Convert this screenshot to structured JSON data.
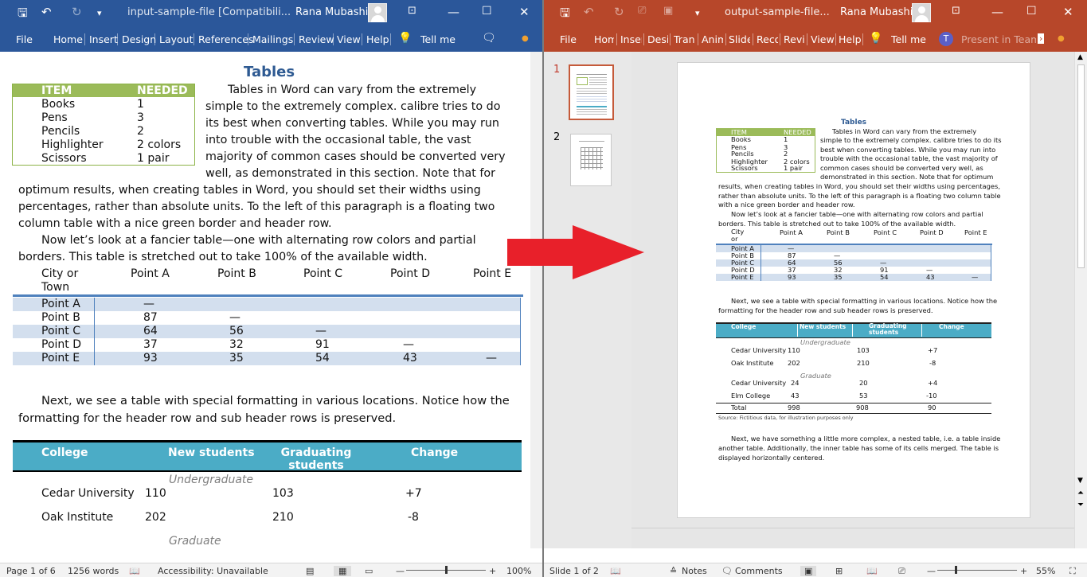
{
  "word": {
    "title": "input-sample-file [Compatibili...",
    "user": "Rana Mubashir",
    "menu": [
      "File",
      "Home",
      "Insert",
      "Design",
      "Layout",
      "References",
      "Mailings",
      "Review",
      "View",
      "Help",
      "Tell me"
    ],
    "doc": {
      "title": "Tables",
      "green_table": {
        "headers": [
          "ITEM",
          "NEEDED"
        ],
        "rows": [
          [
            "Books",
            "1"
          ],
          [
            "Pens",
            "3"
          ],
          [
            "Pencils",
            "2"
          ],
          [
            "Highlighter",
            "2 colors"
          ],
          [
            "Scissors",
            "1 pair"
          ]
        ]
      },
      "para1_lines": [
        "Tables in Word can vary from the extremely",
        "simple to the extremely complex. calibre tries to do",
        "its best when converting tables. While you may run",
        "into trouble with the occasional table, the vast",
        "majority of common cases should be converted very",
        "well, as demonstrated in this section. Note that for",
        "optimum results, when creating tables in Word, you should set their widths using",
        "percentages, rather than absolute units.  To the left of this paragraph is a floating two",
        "column table with a nice green border and header row."
      ],
      "para2_lines": [
        "Now let’s look at a fancier table—one with alternating row colors and partial",
        "borders. This table is stretched out to take 100% of the available width."
      ],
      "fancy_table": {
        "headers": [
          "City or Town",
          "Point A",
          "Point B",
          "Point C",
          "Point D",
          "Point E"
        ],
        "rows": [
          [
            "Point A",
            "—",
            "",
            "",
            "",
            ""
          ],
          [
            "Point B",
            "87",
            "—",
            "",
            "",
            ""
          ],
          [
            "Point C",
            "64",
            "56",
            "—",
            "",
            ""
          ],
          [
            "Point D",
            "37",
            "32",
            "91",
            "—",
            ""
          ],
          [
            "Point E",
            "93",
            "35",
            "54",
            "43",
            "—"
          ]
        ]
      },
      "para3_lines": [
        "Next, we see a table with special formatting in various locations. Notice how the",
        "formatting for the header row and sub header rows is preserved."
      ],
      "college_table": {
        "headers": [
          "College",
          "New students",
          "Graduating students",
          "Change"
        ],
        "sub1": "Undergraduate",
        "rows": [
          [
            "Cedar University",
            "110",
            "103",
            "+7"
          ],
          [
            "Oak Institute",
            "202",
            "210",
            "-8"
          ]
        ],
        "sub2": "Graduate"
      }
    },
    "status": {
      "page": "Page 1 of 6",
      "words": "1256 words",
      "accessibility": "Accessibility: Unavailable",
      "zoom": "100%"
    }
  },
  "ppt": {
    "title": "output-sample-file...",
    "user": "Rana Mubashir",
    "menu": [
      "File",
      "Home",
      "Insert",
      "Design",
      "Transitions",
      "Animations",
      "Slide Show",
      "Record",
      "Review",
      "View",
      "Help",
      "Tell me",
      "Present in Teams"
    ],
    "slides": [
      "1",
      "2"
    ],
    "slide": {
      "title": "Tables",
      "green_headers": [
        "ITEM",
        "NEEDED"
      ],
      "green_rows": [
        [
          "Books",
          "1"
        ],
        [
          "Pens",
          "3"
        ],
        [
          "Pencils",
          "2"
        ],
        [
          "Highlighter",
          "2 colors"
        ],
        [
          "Scissors",
          "1 pair"
        ]
      ],
      "para1_lines": [
        "Tables in Word can vary from the extremely",
        "simple to the extremely complex. calibre tries to do its",
        "best when converting tables. While you may run into",
        "trouble with the occasional table, the vast majority of",
        "common cases should be converted very well, as",
        "demonstrated in this section. Note that for optimum"
      ],
      "para1_cont": [
        "results, when creating tables in Word, you should set their widths using percentages,",
        "rather than absolute units.  To the left of this paragraph is a floating two column table",
        "with a nice green border and header row."
      ],
      "para2_lines": [
        "Now let’s look at a fancier table—one with alternating row colors and partial",
        "borders. This table is stretched out to take 100% of the available width."
      ],
      "fancy_headers": [
        "City or Town",
        "Point A",
        "Point B",
        "Point C",
        "Point D",
        "Point E"
      ],
      "fancy_rows": [
        [
          "Point A",
          "—",
          "",
          "",
          "",
          ""
        ],
        [
          "Point B",
          "87",
          "—",
          "",
          "",
          ""
        ],
        [
          "Point C",
          "64",
          "56",
          "—",
          "",
          ""
        ],
        [
          "Point D",
          "37",
          "32",
          "91",
          "—",
          ""
        ],
        [
          "Point E",
          "93",
          "35",
          "54",
          "43",
          "—"
        ]
      ],
      "para3_lines": [
        "Next, we see a table with special formatting in various locations. Notice how the",
        "formatting for the header row and sub header rows is preserved."
      ],
      "college_headers": [
        "College",
        "New students",
        "Graduating students",
        "Change"
      ],
      "sub1": "Undergraduate",
      "ug_rows": [
        [
          "Cedar University",
          "110",
          "103",
          "+7"
        ],
        [
          "Oak Institute",
          "202",
          "210",
          "-8"
        ]
      ],
      "sub2": "Graduate",
      "g_rows": [
        [
          "Cedar University",
          "24",
          "20",
          "+4"
        ],
        [
          "Elm College",
          "43",
          "53",
          "-10"
        ]
      ],
      "total": [
        "Total",
        "998",
        "908",
        "90"
      ],
      "source": "Source: Fictitious data, for illustration purposes only",
      "para4_lines": [
        "Next, we have something a little more complex, a nested table, i.e. a table inside",
        "another table. Additionally, the inner table has some of its cells merged. The table is",
        "displayed horizontally centered."
      ]
    },
    "status": {
      "slide": "Slide 1 of 2",
      "notes": "Notes",
      "comments": "Comments",
      "zoom": "55%"
    }
  },
  "colors": {
    "word": "#2b579a",
    "ppt": "#b7472a",
    "arrow": "#e8202a",
    "green": "#9bbb59",
    "blue": "#4f81bd",
    "teal": "#4bacc6"
  }
}
